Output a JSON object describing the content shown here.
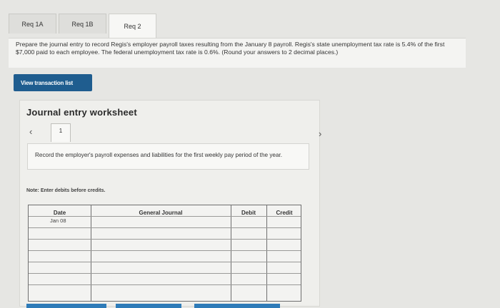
{
  "tabs": [
    {
      "label": "Req 1A"
    },
    {
      "label": "Req 1B"
    },
    {
      "label": "Req 2"
    }
  ],
  "instructions": "Prepare the journal entry to record Regis's employer payroll taxes resulting from the January 8 payroll. Regis's state unemployment tax rate is 5.4% of the first $7,000 paid to each employee. The federal unemployment tax rate is 0.6%. (Round your answers to 2 decimal places.)",
  "view_transaction_button": "View transaction list",
  "worksheet": {
    "title": "Journal entry worksheet",
    "page_number": "1",
    "description": "Record the employer's payroll expenses and liabilities for the first weekly pay period of the year.",
    "note": "Note: Enter debits before credits.",
    "columns": {
      "date": "Date",
      "general_journal": "General Journal",
      "debit": "Debit",
      "credit": "Credit"
    },
    "rows": [
      {
        "date": "Jan 08",
        "account": "",
        "debit": "",
        "credit": ""
      },
      {
        "date": "",
        "account": "",
        "debit": "",
        "credit": ""
      },
      {
        "date": "",
        "account": "",
        "debit": "",
        "credit": ""
      },
      {
        "date": "",
        "account": "",
        "debit": "",
        "credit": ""
      },
      {
        "date": "",
        "account": "",
        "debit": "",
        "credit": ""
      },
      {
        "date": "",
        "account": "",
        "debit": "",
        "credit": ""
      },
      {
        "date": "",
        "account": "",
        "debit": "",
        "credit": ""
      }
    ]
  },
  "colors": {
    "button_blue": "#1f5d8f",
    "background": "#e6e6e3"
  },
  "icons": {
    "prev": "chevron-left-icon",
    "next": "chevron-right-icon"
  }
}
